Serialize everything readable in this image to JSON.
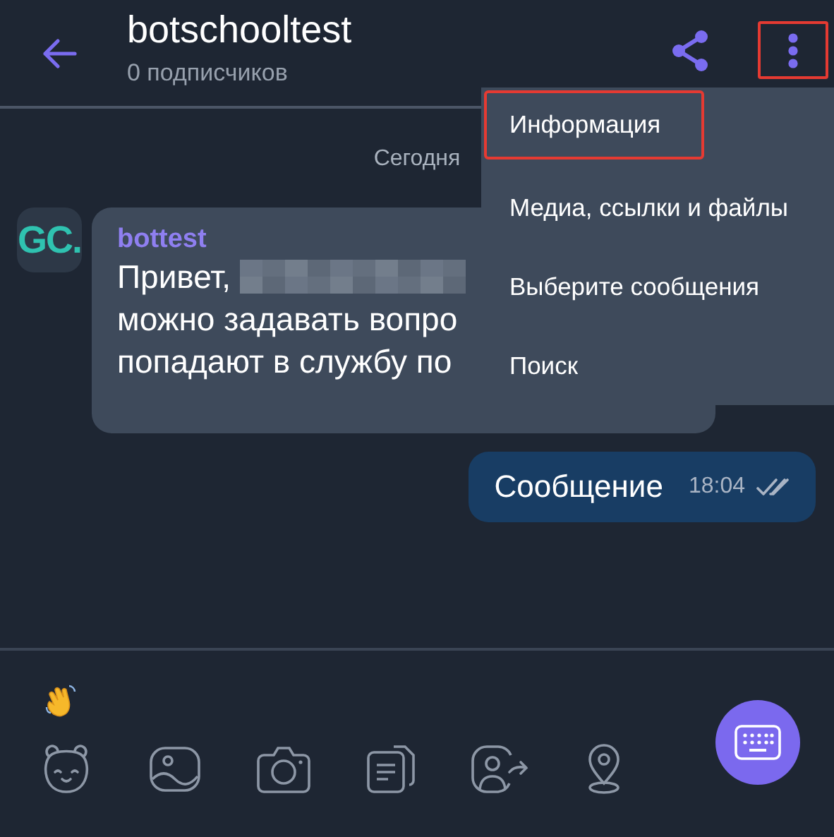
{
  "header": {
    "title": "botschooltest",
    "subtitle": "0 подписчиков",
    "more_highlighted": true
  },
  "date_divider": "Сегодня",
  "messages": [
    {
      "kind": "incoming",
      "avatar": "GC.",
      "sender": "bottest",
      "lines": [
        {
          "text": "Привет,",
          "redacted": true
        },
        {
          "text": "можно задавать вопро",
          "redacted": false
        },
        {
          "text": "попадают в службу по",
          "redacted": false
        }
      ]
    },
    {
      "kind": "outgoing",
      "text": "Сообщение",
      "time": "18:04",
      "read": true
    }
  ],
  "menu": {
    "items": [
      {
        "label": "Информация",
        "highlighted": true
      },
      {
        "label": "Медиа, ссылки и файлы",
        "highlighted": false
      },
      {
        "label": "Выберите сообщения",
        "highlighted": false
      },
      {
        "label": "Поиск",
        "highlighted": false
      }
    ]
  }
}
